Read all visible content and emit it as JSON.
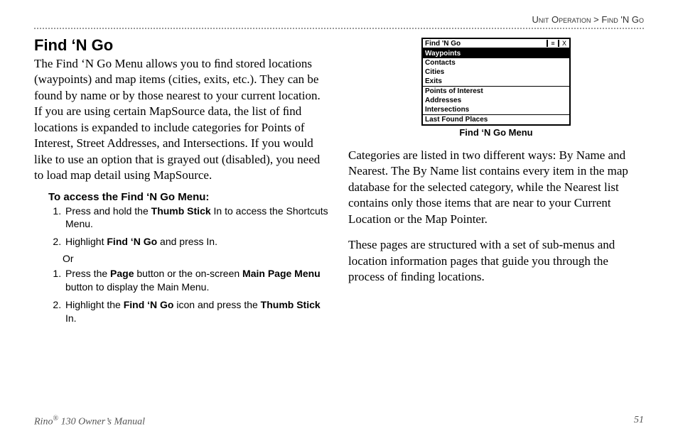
{
  "breadcrumb": {
    "a": "Unit Operation",
    "sep": ">",
    "b": "Find 'N Go"
  },
  "left": {
    "title": "Find ‘N Go",
    "intro": "The Find ‘N Go Menu allows you to ﬁnd stored locations (waypoints) and map items (cities, exits, etc.). They can be found by name or by those nearest to your current location. If you are using certain MapSource data, the list of ﬁnd locations is expanded to include categories for Points of Interest, Street Addresses, and Intersections. If you would like to use an option that is grayed out (disabled), you need to load map detail using MapSource.",
    "subhead": "To access the Find ‘N Go Menu:",
    "stepsA": {
      "s1a": "Press and hold the ",
      "s1b": "Thumb Stick",
      "s1c": " In to access the Shortcuts Menu.",
      "s2a": "Highlight ",
      "s2b": "Find ‘N Go",
      "s2c": " and press In."
    },
    "or": "Or",
    "stepsB": {
      "s1a": "Press the ",
      "s1b": "Page",
      "s1c": " button or the on-screen ",
      "s1d": "Main Page Menu",
      "s1e": " button to display the Main Menu.",
      "s2a": "Highlight the ",
      "s2b": "Find ‘N Go",
      "s2c": " icon and press the ",
      "s2d": "Thumb Stick",
      "s2e": " In."
    }
  },
  "menu": {
    "title": "Find 'N Go",
    "btnMenu": "≡",
    "btnClose": "X",
    "items": {
      "i0": "Waypoints",
      "i1": "Contacts",
      "i2": "Cities",
      "i3": "Exits",
      "i4": "Points of Interest",
      "i5": "Addresses",
      "i6": "Intersections",
      "i7": "Last Found Places"
    },
    "caption": "Find ‘N Go Menu"
  },
  "right": {
    "p1": "Categories are listed in two different ways: By Name and Nearest. The By Name list contains every item in the map database for the selected category, while the Nearest list contains only those items that are near to your Current Location or the Map Pointer.",
    "p2": "These pages are structured with a set of sub-menus and location information pages that guide you through the process of ﬁnding locations."
  },
  "footer": {
    "product_a": "Rino",
    "product_b": " 130 Owner’s Manual",
    "pagenum": "51"
  }
}
